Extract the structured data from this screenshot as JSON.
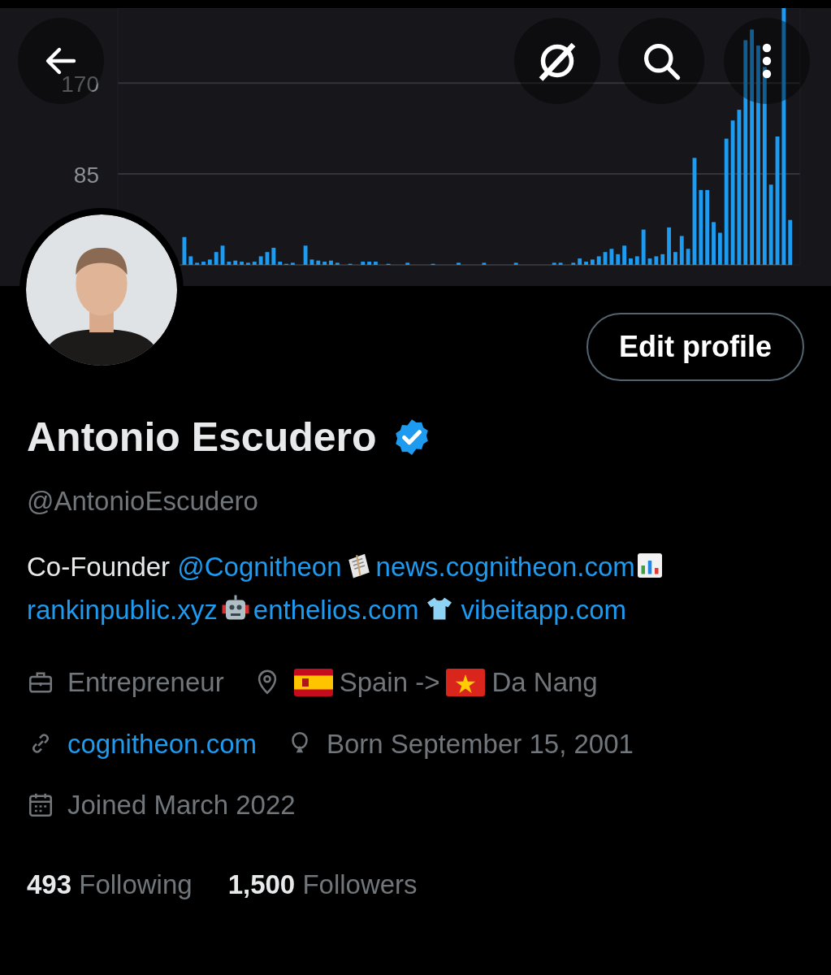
{
  "banner": {
    "chart_data": {
      "type": "bar",
      "ylim": [
        0,
        240
      ],
      "yticks": [
        85,
        170
      ],
      "values": [
        null,
        null,
        null,
        null,
        null,
        null,
        null,
        null,
        null,
        null,
        26,
        8,
        2,
        3,
        5,
        12,
        18,
        3,
        4,
        3,
        2,
        3,
        8,
        12,
        16,
        3,
        1,
        2,
        0,
        18,
        5,
        4,
        3,
        4,
        2,
        0,
        1,
        0,
        3,
        3,
        3,
        0,
        1,
        0,
        0,
        2,
        0,
        0,
        0,
        1,
        0,
        0,
        0,
        2,
        0,
        0,
        0,
        2,
        0,
        0,
        0,
        0,
        2,
        0,
        0,
        0,
        0,
        0,
        2,
        2,
        0,
        2,
        6,
        3,
        5,
        8,
        12,
        15,
        10,
        18,
        6,
        8,
        33,
        6,
        8,
        10,
        35,
        12,
        27,
        15,
        100,
        70,
        70,
        40,
        30,
        118,
        135,
        145,
        210,
        220,
        205,
        185,
        75,
        120,
        240,
        42,
        null
      ],
      "color": "#1d9bf0"
    }
  },
  "top_bar": {
    "buttons": [
      {
        "kind": "back"
      },
      {
        "kind": "slash"
      },
      {
        "kind": "search"
      },
      {
        "kind": "more"
      }
    ]
  },
  "edit_button": "Edit profile",
  "name": "Antonio Escudero",
  "verified": true,
  "handle": "@AntonioEscudero",
  "bio": [
    {
      "kind": "text",
      "text": "Co-Founder "
    },
    {
      "kind": "link",
      "text": "@Cognitheon"
    },
    {
      "kind": "icon"
    },
    {
      "kind": "link",
      "text": "news.cognitheon.com"
    },
    {
      "kind": "icon"
    },
    {
      "kind": "link",
      "text": "rankinpublic.xyz"
    },
    {
      "kind": "icon"
    },
    {
      "kind": "link",
      "text": "enthelios.com"
    },
    {
      "kind": "icon"
    },
    {
      "kind": "link",
      "text": "vibeitapp.com"
    }
  ],
  "meta": [
    {
      "kind": "work",
      "parts": [
        {
          "kind": "text",
          "text": "Entrepreneur"
        }
      ]
    },
    {
      "kind": "location",
      "parts": [
        {
          "kind": "flag"
        },
        {
          "kind": "text",
          "text": "Spain ->"
        },
        {
          "kind": "flag"
        },
        {
          "kind": "text",
          "text": "Da Nang"
        }
      ]
    },
    {
      "kind": "website",
      "parts": [
        {
          "kind": "link",
          "text": "cognitheon.com"
        }
      ]
    },
    {
      "kind": "birthday",
      "parts": [
        {
          "kind": "text",
          "text": "Born September 15, 2001"
        }
      ]
    },
    {
      "kind": "joined",
      "parts": [
        {
          "kind": "text",
          "text": "Joined March 2022"
        }
      ]
    }
  ],
  "stats": [
    {
      "count": "493",
      "label": "Following"
    },
    {
      "count": "1,500",
      "label": "Followers"
    }
  ]
}
